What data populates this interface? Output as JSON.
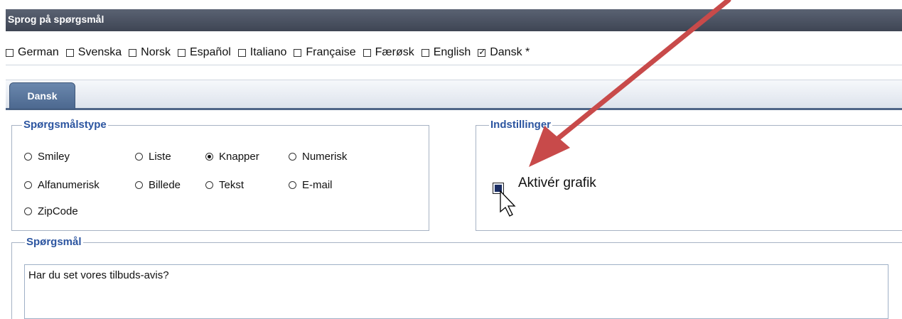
{
  "language_section": {
    "title": "Sprog på spørgsmål",
    "languages": [
      {
        "label": "German",
        "checked": false
      },
      {
        "label": "Svenska",
        "checked": false
      },
      {
        "label": "Norsk",
        "checked": false
      },
      {
        "label": "Español",
        "checked": false
      },
      {
        "label": "Italiano",
        "checked": false
      },
      {
        "label": "Française",
        "checked": false
      },
      {
        "label": "Færøsk",
        "checked": false
      },
      {
        "label": "English",
        "checked": false
      },
      {
        "label": "Dansk *",
        "checked": true
      }
    ]
  },
  "tabs": [
    {
      "label": "Dansk",
      "active": true
    }
  ],
  "question_type": {
    "legend": "Spørgsmålstype",
    "options": [
      {
        "label": "Smiley",
        "selected": false
      },
      {
        "label": "Liste",
        "selected": false
      },
      {
        "label": "Knapper",
        "selected": true
      },
      {
        "label": "Numerisk",
        "selected": false
      },
      {
        "label": "Alfanumerisk",
        "selected": false
      },
      {
        "label": "Billede",
        "selected": false
      },
      {
        "label": "Tekst",
        "selected": false
      },
      {
        "label": "E-mail",
        "selected": false
      },
      {
        "label": "ZipCode",
        "selected": false
      }
    ]
  },
  "settings": {
    "legend": "Indstillinger",
    "enable_graphics_label": "Aktivér grafik",
    "enable_graphics_checked": true
  },
  "question": {
    "legend": "Spørgsmål",
    "value": "Har du set vores tilbuds-avis?"
  },
  "icons": {
    "arrow": "annotation-arrow-icon",
    "cursor": "mouse-pointer-icon"
  },
  "colors": {
    "header_bg": "#4a5262",
    "tab_bg": "#5a77a0",
    "legend_text": "#2c55a0",
    "arrow": "#c84a4a"
  }
}
